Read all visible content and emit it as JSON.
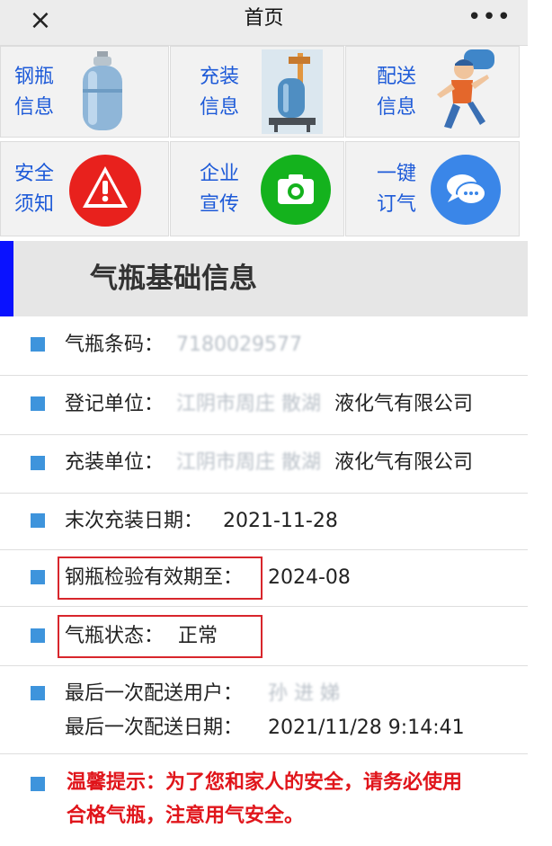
{
  "header": {
    "title": "首页",
    "close_glyph": "×",
    "more_glyph": "•••"
  },
  "tiles": [
    {
      "line1": "钢瓶",
      "line2": "信息",
      "icon": "gas-cylinder-icon"
    },
    {
      "line1": "充装",
      "line2": "信息",
      "icon": "filling-scale-icon"
    },
    {
      "line1": "配送",
      "line2": "信息",
      "icon": "delivery-man-icon"
    },
    {
      "line1": "安全",
      "line2": "须知",
      "icon": "warning-icon",
      "color": "#e8211d"
    },
    {
      "line1": "企业",
      "line2": "宣传",
      "icon": "camera-icon",
      "color": "#14b21d"
    },
    {
      "line1": "一键",
      "line2": "订气",
      "icon": "chat-bubble-icon",
      "color": "#3a86e8"
    }
  ],
  "section": {
    "title": "气瓶基础信息",
    "accent": "#0a12ff"
  },
  "info": {
    "barcode_label": "气瓶条码：",
    "barcode_value": "7180029577",
    "reg_unit_label": "登记单位：",
    "reg_unit_value_blurred": "江阴市周庄 散湖",
    "reg_unit_value": "液化气有限公司",
    "fill_unit_label": "充装单位：",
    "fill_unit_value_blurred": "江阴市周庄 散湖",
    "fill_unit_value": "液化气有限公司",
    "last_fill_label": "末次充装日期：",
    "last_fill_value": "2021-11-28",
    "inspect_label": "钢瓶检验有效期至：",
    "inspect_value": "2024-08",
    "status_label": "气瓶状态：",
    "status_value": "正常",
    "last_user_label": "最后一次配送用户：",
    "last_user_value": "孙 进 娣",
    "last_date_label": "最后一次配送日期：",
    "last_date_value": "2021/11/28 9:14:41"
  },
  "tip": {
    "line1": "温馨提示：为了您和家人的安全，请务必使用",
    "line2": "合格气瓶，注意用气安全。",
    "color": "#e0151b"
  },
  "colors": {
    "bullet": "#3e94dc",
    "tile_text": "#1d5ad8",
    "highlight_box": "#d8262c"
  }
}
